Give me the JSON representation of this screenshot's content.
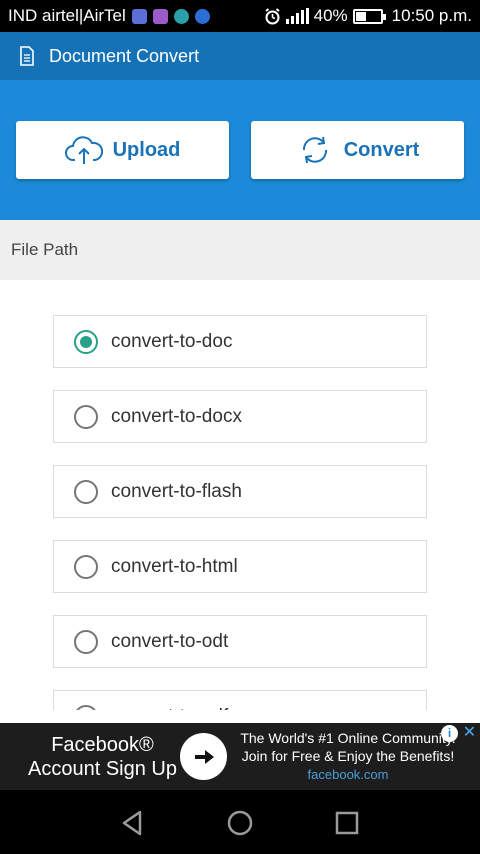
{
  "status_bar": {
    "carrier": "IND airtel|AirTel",
    "battery_percent": "40%",
    "battery_level": 0.4,
    "time": "10:50 p.m.",
    "notification_icons": [
      "gallery-icon",
      "photos-icon",
      "settings-icon",
      "sync-icon"
    ],
    "system_icons": [
      "alarm-icon",
      "signal-icon",
      "battery-icon"
    ]
  },
  "app_bar": {
    "title": "Document Convert",
    "icon": "document-icon"
  },
  "actions": {
    "upload_label": "Upload",
    "convert_label": "Convert",
    "upload_icon": "cloud-upload-icon",
    "convert_icon": "sync-arrows-icon"
  },
  "file_path": {
    "label": "File Path"
  },
  "options": [
    {
      "label": "convert-to-doc",
      "checked": true
    },
    {
      "label": "convert-to-docx",
      "checked": false
    },
    {
      "label": "convert-to-flash",
      "checked": false
    },
    {
      "label": "convert-to-html",
      "checked": false
    },
    {
      "label": "convert-to-odt",
      "checked": false
    },
    {
      "label": "convert-to-pdf",
      "checked": false
    }
  ],
  "ad": {
    "left_line1": "Facebook®",
    "left_line2": "Account Sign Up",
    "headline_line1": "The World's #1 Online Community.",
    "headline_line2": "Join for Free & Enjoy the Benefits!",
    "domain": "facebook.com",
    "info": "i",
    "close": "✕"
  },
  "colors": {
    "app_bar": "#1672b6",
    "action_panel": "#1c8ad8",
    "radio_checked": "#26a186",
    "button_text": "#1a73b8"
  }
}
